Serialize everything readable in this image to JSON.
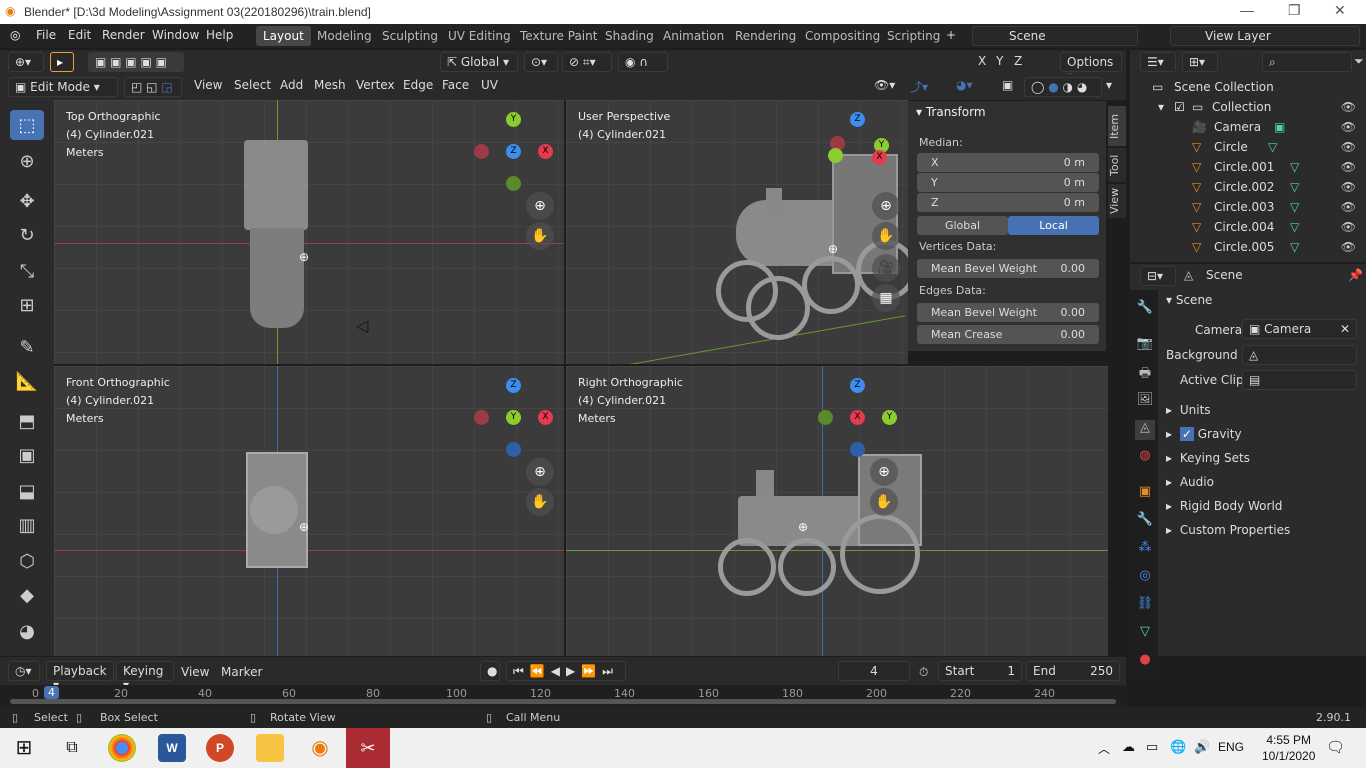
{
  "window": {
    "title": "Blender* [D:\\3d Modeling\\Assignment 03(220180296)\\train.blend]"
  },
  "menu": {
    "items": [
      "File",
      "Edit",
      "Render",
      "Window",
      "Help"
    ]
  },
  "workspaces": [
    "Layout",
    "Modeling",
    "Sculpting",
    "UV Editing",
    "Texture Paint",
    "Shading",
    "Animation",
    "Rendering",
    "Compositing",
    "Scripting"
  ],
  "scene_field": "Scene",
  "view_layer_field": "View Layer",
  "header": {
    "transform_orientation": "Global",
    "options": "Options",
    "mode": "Edit Mode",
    "menus": [
      "View",
      "Select",
      "Add",
      "Mesh",
      "Vertex",
      "Edge",
      "Face",
      "UV"
    ],
    "axes": [
      "X",
      "Y",
      "Z"
    ]
  },
  "viewports": [
    {
      "name": "Top Orthographic",
      "object": "(4) Cylinder.021",
      "units": "Meters"
    },
    {
      "name": "User Perspective",
      "object": "(4) Cylinder.021"
    },
    {
      "name": "Front Orthographic",
      "object": "(4) Cylinder.021",
      "units": "Meters"
    },
    {
      "name": "Right Orthographic",
      "object": "(4) Cylinder.021",
      "units": "Meters"
    }
  ],
  "npanel": {
    "title": "Transform",
    "median": "Median:",
    "x_label": "X",
    "x_val": "0 m",
    "y_label": "Y",
    "y_val": "0 m",
    "z_label": "Z",
    "z_val": "0 m",
    "global": "Global",
    "local": "Local",
    "vertices_data": "Vertices Data:",
    "mean_bevel_weight": "Mean Bevel Weight",
    "vbw_val": "0.00",
    "edges_data": "Edges Data:",
    "ebw_val": "0.00",
    "mean_crease": "Mean Crease",
    "crease_val": "0.00",
    "tabs": [
      "Item",
      "Tool",
      "View"
    ]
  },
  "outliner": {
    "rows": [
      {
        "label": "Scene Collection"
      },
      {
        "label": "Collection"
      },
      {
        "label": "Camera"
      },
      {
        "label": "Circle"
      },
      {
        "label": "Circle.001"
      },
      {
        "label": "Circle.002"
      },
      {
        "label": "Circle.003"
      },
      {
        "label": "Circle.004"
      },
      {
        "label": "Circle.005"
      }
    ]
  },
  "properties": {
    "context": "Scene",
    "section": "Scene",
    "camera_label": "Camera",
    "camera_val": "Camera",
    "background_label": "Background ...",
    "active_clip_label": "Active Clip",
    "panels": [
      "Units",
      "Gravity",
      "Keying Sets",
      "Audio",
      "Rigid Body World",
      "Custom Properties"
    ]
  },
  "timeline": {
    "menus": [
      "Playback",
      "Keying",
      "View",
      "Marker"
    ],
    "current_frame": "4",
    "start_label": "Start",
    "start": "1",
    "end_label": "End",
    "end": "250",
    "ticks": [
      "0",
      "20",
      "40",
      "60",
      "80",
      "100",
      "120",
      "140",
      "160",
      "180",
      "200",
      "220",
      "240"
    ],
    "frame_marker": "4"
  },
  "status": {
    "select": "Select",
    "box_select": "Box Select",
    "rotate_view": "Rotate View",
    "call_menu": "Call Menu",
    "version": "2.90.1"
  },
  "taskbar": {
    "time": "4:55 PM",
    "date": "10/1/2020",
    "lang": "ENG"
  },
  "colors": {
    "accent": "#4772b3",
    "x_axis": "#e63a4e",
    "y_axis": "#8bcc2f",
    "z_axis": "#3e8ef0"
  }
}
